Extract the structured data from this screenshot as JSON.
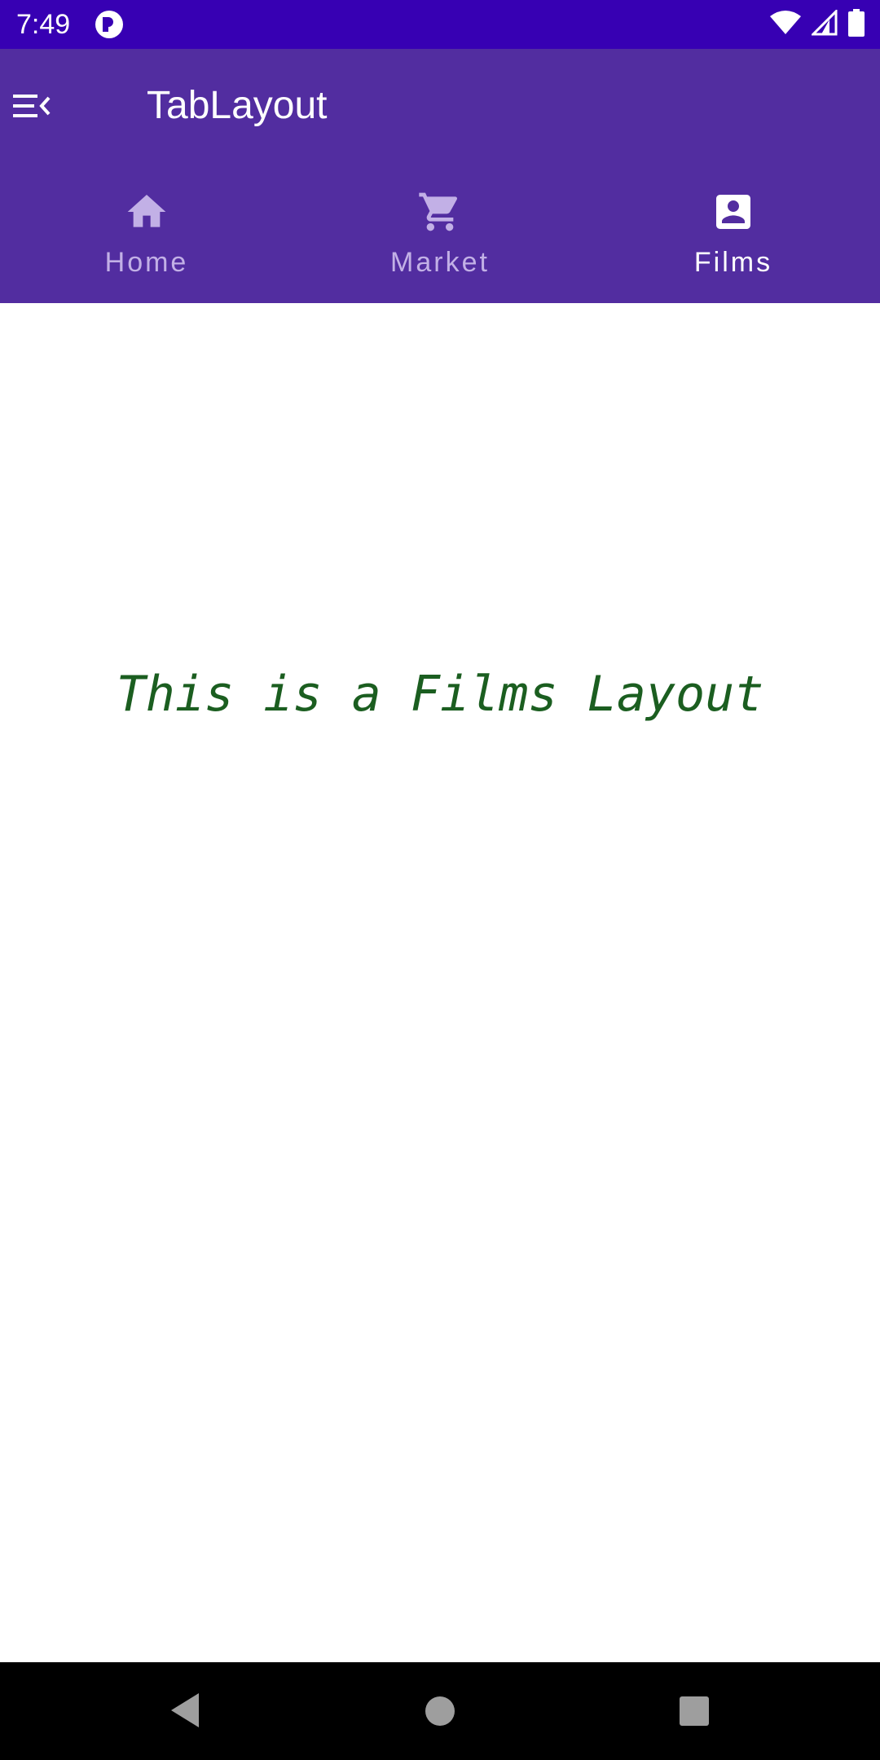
{
  "status_bar": {
    "time": "7:49",
    "app_icon": "notification-app-icon",
    "icons": [
      "wifi-icon",
      "signal-icon",
      "battery-icon"
    ],
    "background": "#3700b3"
  },
  "toolbar": {
    "title": "TabLayout",
    "menu_icon": "menu-collapse-icon",
    "background": "#522da0"
  },
  "tabs": [
    {
      "label": "Home",
      "icon": "home-icon",
      "selected": false
    },
    {
      "label": "Market",
      "icon": "cart-icon",
      "selected": false
    },
    {
      "label": "Films",
      "icon": "account-box-icon",
      "selected": true
    }
  ],
  "tab_indicator_color": "#ff1010",
  "content": {
    "text": "This is a Films Layout",
    "text_color": "#1b5e20"
  },
  "nav_bar": {
    "buttons": [
      "back-icon",
      "home-circle-icon",
      "recents-icon"
    ]
  }
}
